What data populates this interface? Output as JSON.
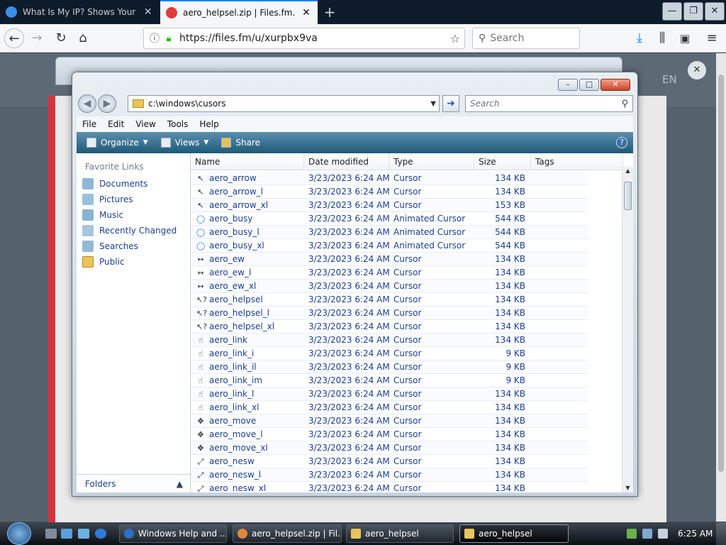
{
  "browser": {
    "tabs": [
      {
        "title": "What Is My IP? Shows Your Pu",
        "active": false
      },
      {
        "title": "aero_helpsel.zip | Files.fm.",
        "active": true
      }
    ],
    "url": "https://files.fm/u/xurpbx9va",
    "search_placeholder": "Search",
    "accent_color": "#0a84ff"
  },
  "explorer": {
    "address_path": "c:\\windows\\cusors",
    "search_placeholder": "Search",
    "menu": [
      "File",
      "Edit",
      "View",
      "Tools",
      "Help"
    ],
    "commands": {
      "organize": "Organize",
      "views": "Views",
      "share": "Share"
    },
    "nav_title": "Favorite Links",
    "nav_items": [
      {
        "label": "Documents",
        "icon": "documents-icon"
      },
      {
        "label": "Pictures",
        "icon": "pictures-icon"
      },
      {
        "label": "Music",
        "icon": "music-icon"
      },
      {
        "label": "Recently Changed",
        "icon": "recently-changed-icon"
      },
      {
        "label": "Searches",
        "icon": "searches-icon"
      },
      {
        "label": "Public",
        "icon": "folder-icon"
      }
    ],
    "folders_label": "Folders",
    "columns": {
      "name": "Name",
      "date": "Date modified",
      "type": "Type",
      "size": "Size",
      "tags": "Tags"
    },
    "files": [
      {
        "name": "aero_arrow",
        "date": "3/23/2023 6:24 AM",
        "type": "Cursor",
        "size": "134 KB"
      },
      {
        "name": "aero_arrow_l",
        "date": "3/23/2023 6:24 AM",
        "type": "Cursor",
        "size": "134 KB"
      },
      {
        "name": "aero_arrow_xl",
        "date": "3/23/2023 6:24 AM",
        "type": "Cursor",
        "size": "153 KB"
      },
      {
        "name": "aero_busy",
        "date": "3/23/2023 6:24 AM",
        "type": "Animated Cursor",
        "size": "544 KB"
      },
      {
        "name": "aero_busy_l",
        "date": "3/23/2023 6:24 AM",
        "type": "Animated Cursor",
        "size": "544 KB"
      },
      {
        "name": "aero_busy_xl",
        "date": "3/23/2023 6:24 AM",
        "type": "Animated Cursor",
        "size": "544 KB"
      },
      {
        "name": "aero_ew",
        "date": "3/23/2023 6:24 AM",
        "type": "Cursor",
        "size": "134 KB"
      },
      {
        "name": "aero_ew_l",
        "date": "3/23/2023 6:24 AM",
        "type": "Cursor",
        "size": "134 KB"
      },
      {
        "name": "aero_ew_xl",
        "date": "3/23/2023 6:24 AM",
        "type": "Cursor",
        "size": "134 KB"
      },
      {
        "name": "aero_helpsel",
        "date": "3/23/2023 6:24 AM",
        "type": "Cursor",
        "size": "134 KB"
      },
      {
        "name": "aero_helpsel_l",
        "date": "3/23/2023 6:24 AM",
        "type": "Cursor",
        "size": "134 KB"
      },
      {
        "name": "aero_helpsel_xl",
        "date": "3/23/2023 6:24 AM",
        "type": "Cursor",
        "size": "134 KB"
      },
      {
        "name": "aero_link",
        "date": "3/23/2023 6:24 AM",
        "type": "Cursor",
        "size": "134 KB"
      },
      {
        "name": "aero_link_i",
        "date": "3/23/2023 6:24 AM",
        "type": "Cursor",
        "size": "9 KB"
      },
      {
        "name": "aero_link_il",
        "date": "3/23/2023 6:24 AM",
        "type": "Cursor",
        "size": "9 KB"
      },
      {
        "name": "aero_link_im",
        "date": "3/23/2023 6:24 AM",
        "type": "Cursor",
        "size": "9 KB"
      },
      {
        "name": "aero_link_l",
        "date": "3/23/2023 6:24 AM",
        "type": "Cursor",
        "size": "134 KB"
      },
      {
        "name": "aero_link_xl",
        "date": "3/23/2023 6:24 AM",
        "type": "Cursor",
        "size": "134 KB"
      },
      {
        "name": "aero_move",
        "date": "3/23/2023 6:24 AM",
        "type": "Cursor",
        "size": "134 KB"
      },
      {
        "name": "aero_move_l",
        "date": "3/23/2023 6:24 AM",
        "type": "Cursor",
        "size": "134 KB"
      },
      {
        "name": "aero_move_xl",
        "date": "3/23/2023 6:24 AM",
        "type": "Cursor",
        "size": "134 KB"
      },
      {
        "name": "aero_nesw",
        "date": "3/23/2023 6:24 AM",
        "type": "Cursor",
        "size": "134 KB"
      },
      {
        "name": "aero_nesw_l",
        "date": "3/23/2023 6:24 AM",
        "type": "Cursor",
        "size": "134 KB"
      },
      {
        "name": "aero_nesw_xl",
        "date": "3/23/2023 6:24 AM",
        "type": "Cursor",
        "size": "134 KB"
      }
    ]
  },
  "taskbar": {
    "items": [
      {
        "label": "Windows Help and ...",
        "active": false
      },
      {
        "label": "aero_helpsel.zip | Fil...",
        "active": false
      },
      {
        "label": "aero_helpsel",
        "active": false
      },
      {
        "label": "aero_helpsel",
        "active": true
      }
    ],
    "clock": "6:25 AM"
  },
  "page_bg": {
    "lang": "EN",
    "close_label": "✕"
  }
}
